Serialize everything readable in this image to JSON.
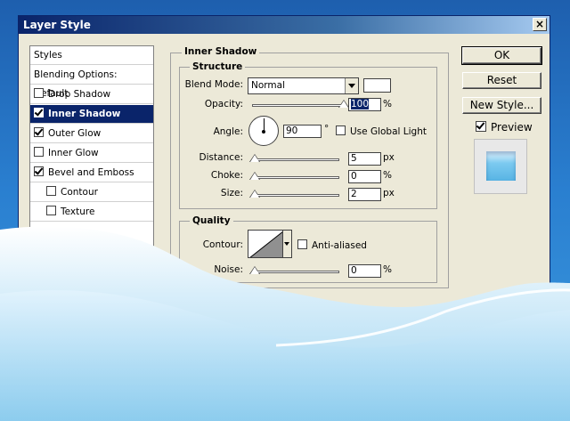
{
  "window": {
    "title": "Layer Style",
    "close_glyph": "×"
  },
  "styles_list": {
    "items": [
      {
        "label": "Styles",
        "checkbox": false,
        "checked": false,
        "selected": false,
        "indent": 0
      },
      {
        "label": "Blending Options: Default",
        "checkbox": false,
        "checked": false,
        "selected": false,
        "indent": 0
      },
      {
        "label": "Drop Shadow",
        "checkbox": true,
        "checked": false,
        "selected": false,
        "indent": 0
      },
      {
        "label": "Inner Shadow",
        "checkbox": true,
        "checked": true,
        "selected": true,
        "indent": 0
      },
      {
        "label": "Outer Glow",
        "checkbox": true,
        "checked": true,
        "selected": false,
        "indent": 0
      },
      {
        "label": "Inner Glow",
        "checkbox": true,
        "checked": false,
        "selected": false,
        "indent": 0
      },
      {
        "label": "Bevel and Emboss",
        "checkbox": true,
        "checked": true,
        "selected": false,
        "indent": 0
      },
      {
        "label": "Contour",
        "checkbox": true,
        "checked": false,
        "selected": false,
        "indent": 1
      },
      {
        "label": "Texture",
        "checkbox": true,
        "checked": false,
        "selected": false,
        "indent": 1
      }
    ]
  },
  "inner_shadow": {
    "title": "Inner Shadow",
    "structure": {
      "title": "Structure",
      "blend_mode": {
        "label": "Blend Mode:",
        "value": "Normal",
        "swatch_color": "#ffffff"
      },
      "opacity": {
        "label": "Opacity:",
        "value": "100",
        "unit": "%",
        "fraction": 1.0
      },
      "angle": {
        "label": "Angle:",
        "value": "90",
        "unit": "°",
        "degrees": 90
      },
      "use_global_light": {
        "label": "Use Global Light",
        "checked": false
      },
      "distance": {
        "label": "Distance:",
        "value": "5",
        "unit": "px",
        "fraction": 0.0
      },
      "choke": {
        "label": "Choke:",
        "value": "0",
        "unit": "%",
        "fraction": 0.0
      },
      "size": {
        "label": "Size:",
        "value": "2",
        "unit": "px",
        "fraction": 0.0
      }
    },
    "quality": {
      "title": "Quality",
      "contour": {
        "label": "Contour:"
      },
      "anti_aliased": {
        "label": "Anti-aliased",
        "checked": false
      },
      "noise": {
        "label": "Noise:",
        "value": "0",
        "unit": "%",
        "fraction": 0.0
      }
    }
  },
  "buttons": {
    "ok": "OK",
    "reset": "Reset",
    "new_style": "New Style...",
    "preview": {
      "label": "Preview",
      "checked": true
    }
  },
  "colors": {
    "selection": "#0a246a",
    "dialog_bg": "#ece9d8",
    "desktop_blue": "#2a7fd0"
  }
}
